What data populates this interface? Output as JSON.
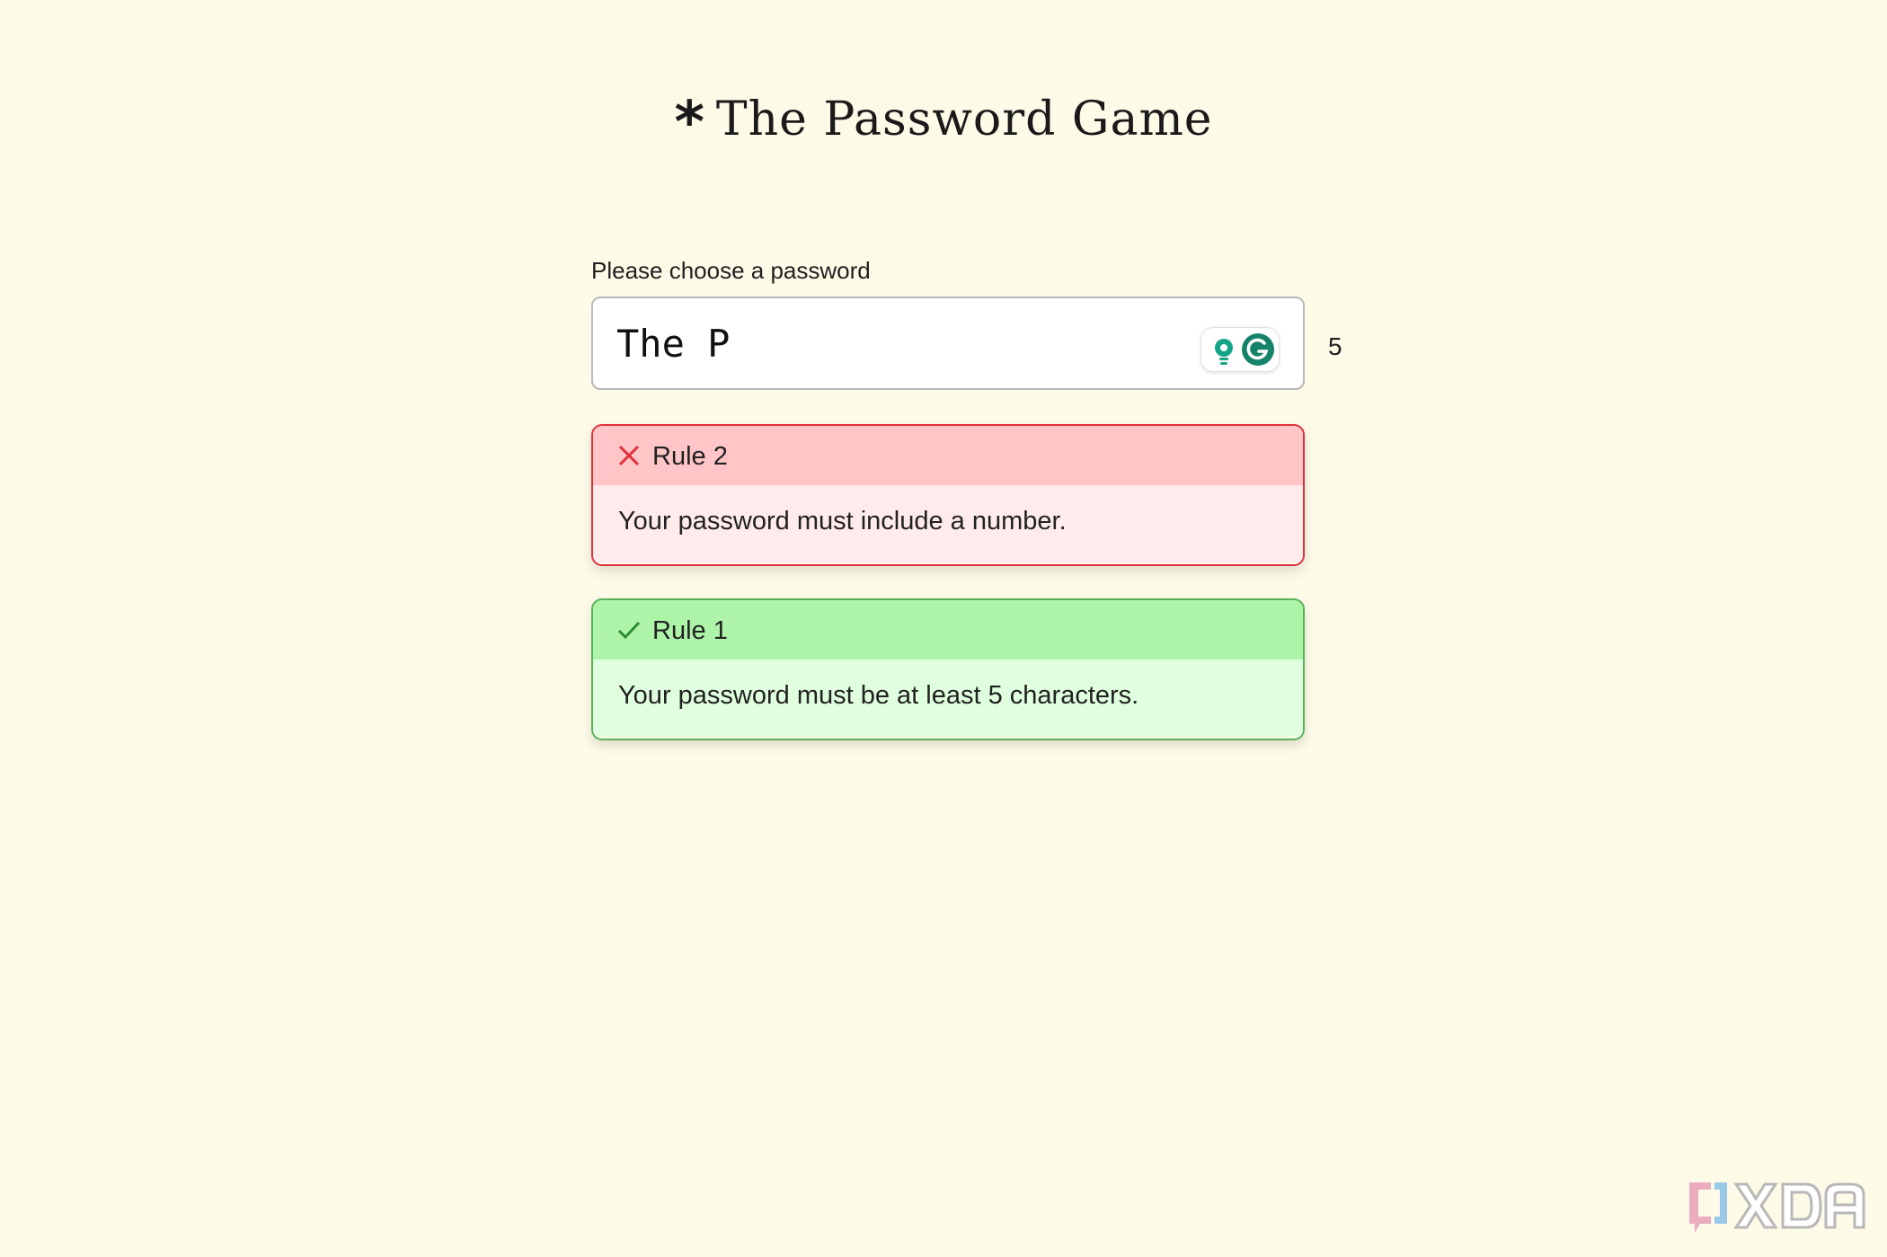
{
  "app": {
    "title_icon": "asterisk-icon",
    "title": "The Password Game"
  },
  "password": {
    "label": "Please choose a password",
    "value": "The P",
    "char_count": "5",
    "tools": [
      "hint-bulb-icon",
      "grammarly-icon"
    ]
  },
  "rules": [
    {
      "name": "Rule 2",
      "status": "failed",
      "status_icon": "x-icon",
      "text": "Your password must include a number.",
      "colors": {
        "border": "#e0303c",
        "header": "#ffc5c7",
        "body": "#ffebeb"
      }
    },
    {
      "name": "Rule 1",
      "status": "passed",
      "status_icon": "checkmark-icon",
      "text": "Your password must be at least 5 characters.",
      "colors": {
        "border": "#55b458",
        "header": "#adf4a9",
        "body": "#e0ffde"
      }
    }
  ],
  "watermark": {
    "icon": "xda-logo"
  },
  "colors": {
    "background": "#fefae8"
  }
}
